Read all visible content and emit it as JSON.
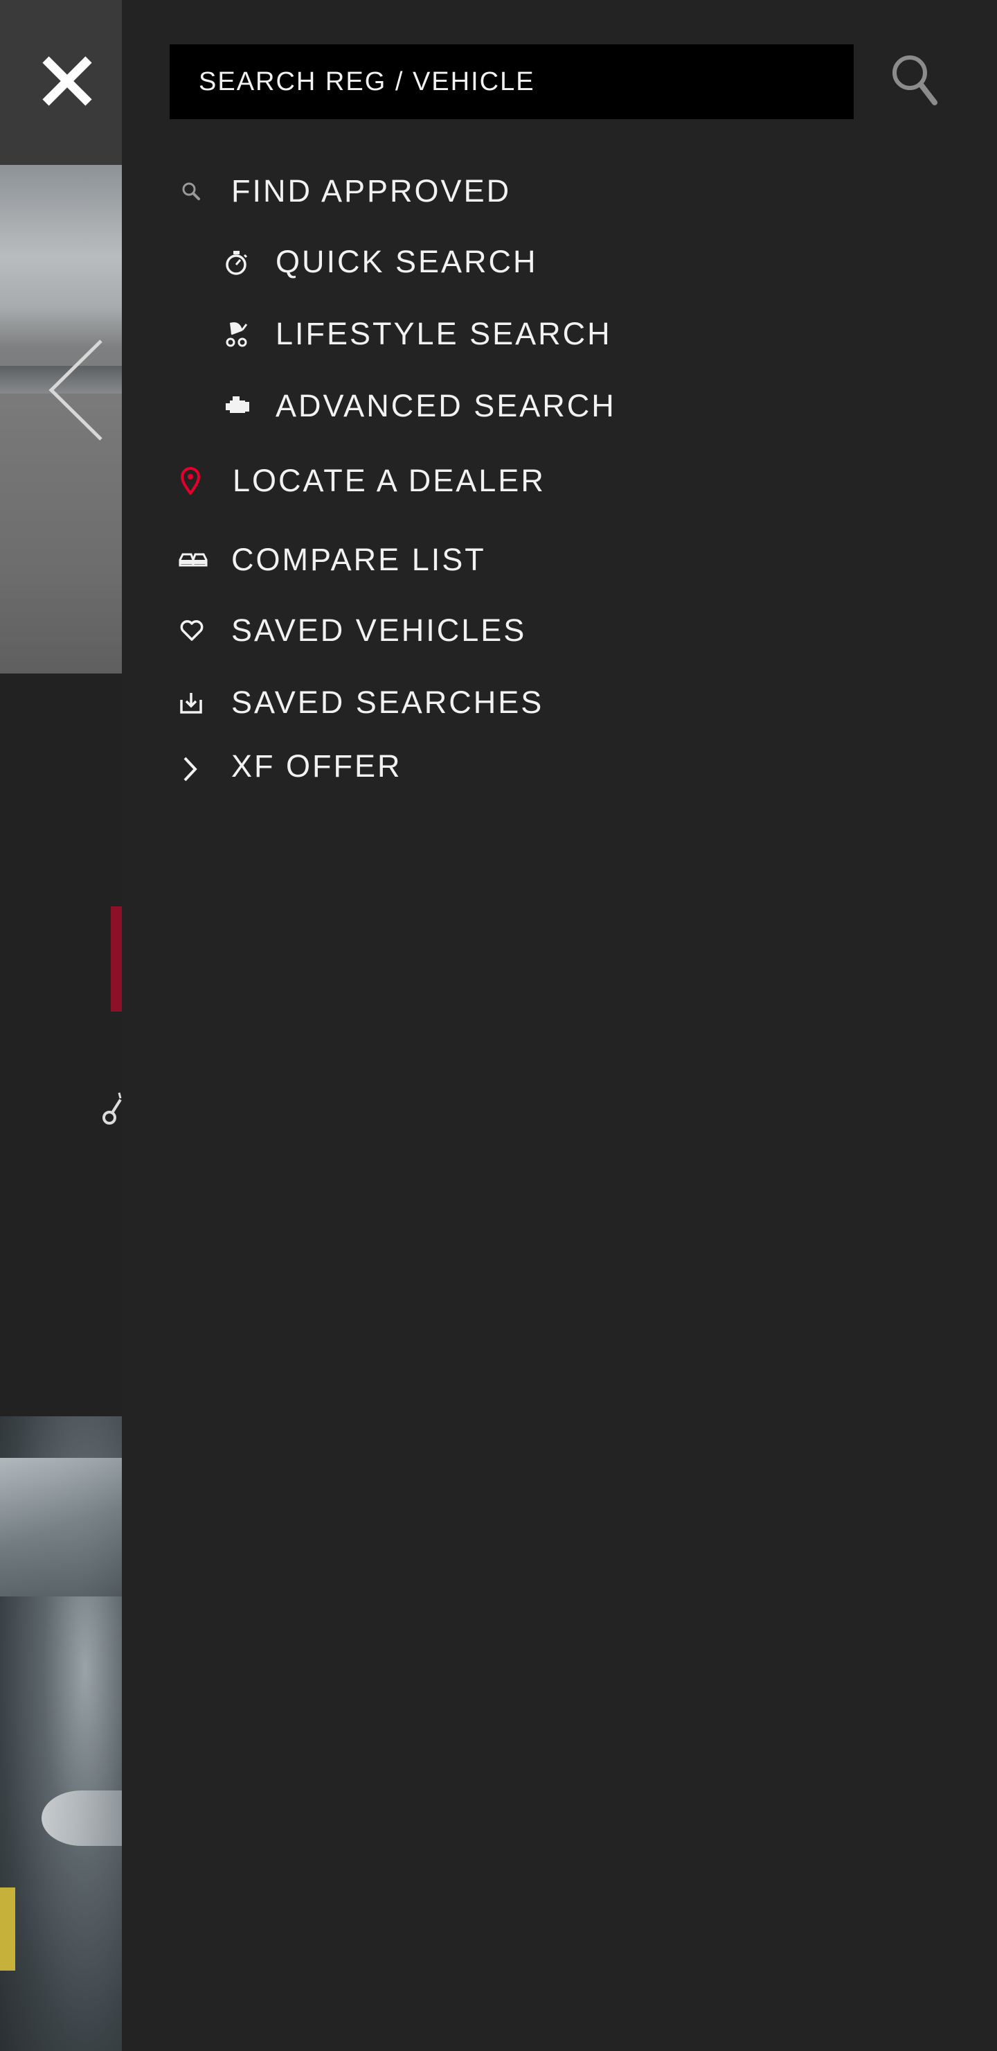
{
  "search": {
    "placeholder": "SEARCH REG / VEHICLE"
  },
  "menu": {
    "find_approved": "FIND APPROVED",
    "quick_search": "QUICK SEARCH",
    "lifestyle_search": "LIFESTYLE SEARCH",
    "advanced_search": "ADVANCED SEARCH",
    "locate_dealer": "LOCATE A DEALER",
    "compare_list": "COMPARE LIST",
    "saved_vehicles": "SAVED VEHICLES",
    "saved_searches": "SAVED SEARCHES",
    "xf_offer": "XF OFFER"
  },
  "icons": {
    "close": "close-icon",
    "search": "search-icon",
    "find": "magnifier-icon",
    "quick": "stopwatch-icon",
    "lifestyle": "stroller-icon",
    "advanced": "engine-icon",
    "dealer": "location-pin-icon",
    "compare": "cars-compare-icon",
    "saved_vehicles": "heart-icon",
    "saved_searches": "download-tray-icon",
    "xf_offer": "chevron-right-icon",
    "back": "chevron-left-icon"
  },
  "colors": {
    "drawer_bg": "#232323",
    "search_bg": "#000000",
    "text": "#f2f2f2",
    "accent_red": "#e4002b",
    "icon_grey": "#9a9a9a"
  }
}
